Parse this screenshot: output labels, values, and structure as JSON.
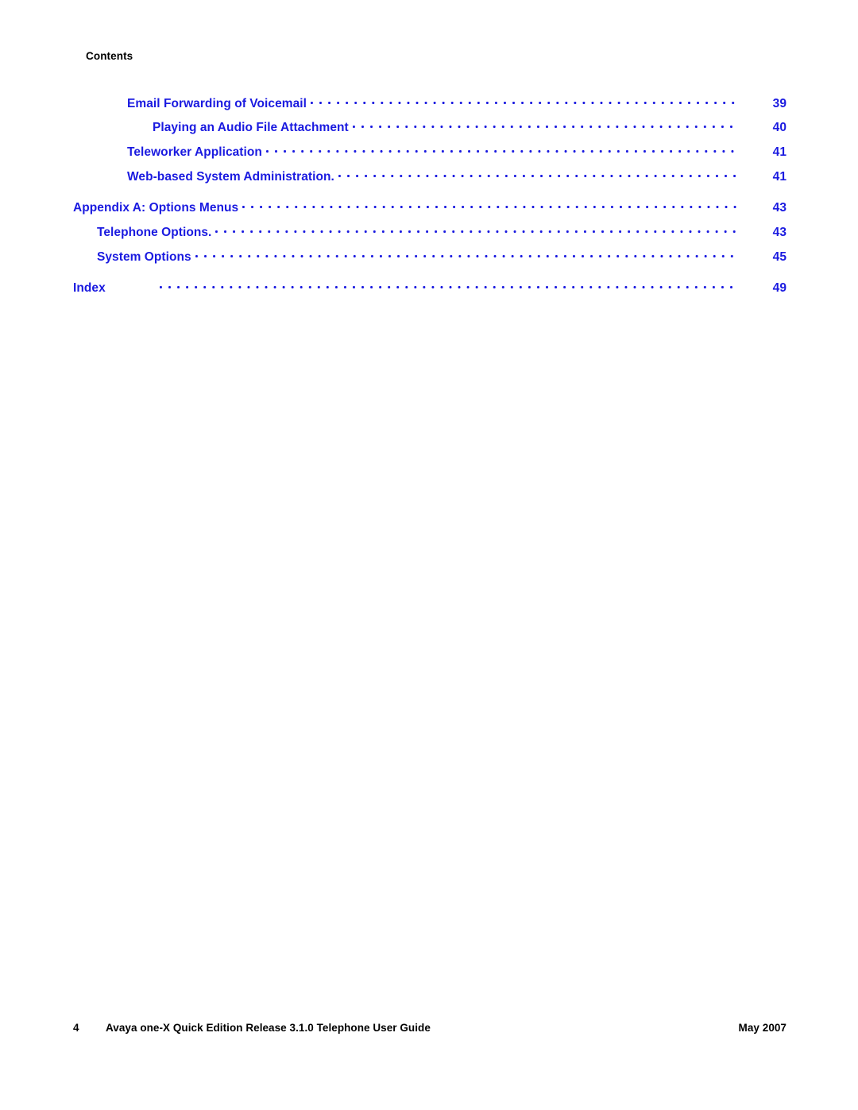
{
  "document": {
    "running_head": "Contents",
    "accent_color": "#1a1ae0",
    "text_color": "#000000",
    "background_color": "#ffffff"
  },
  "toc": {
    "entries": [
      {
        "title": "Email Forwarding of Voicemail",
        "page": "39",
        "level": 2,
        "leader": true,
        "gap_before": false
      },
      {
        "title": "Playing an Audio File Attachment",
        "page": "40",
        "level": 3,
        "leader": true,
        "gap_before": false
      },
      {
        "title": "Teleworker Application",
        "page": "41",
        "level": 2,
        "leader": true,
        "gap_before": false
      },
      {
        "title": "Web-based System Administration.",
        "page": "41",
        "level": 2,
        "leader": true,
        "gap_before": false
      },
      {
        "title": "Appendix A: Options Menus",
        "page": "43",
        "level": 0,
        "leader": true,
        "gap_before": true
      },
      {
        "title": "Telephone Options.",
        "page": "43",
        "level": 1,
        "leader": true,
        "gap_before": false
      },
      {
        "title": "System Options",
        "page": "45",
        "level": 1,
        "leader": true,
        "gap_before": false
      },
      {
        "title": "Index",
        "page": "49",
        "level": 0,
        "leader": true,
        "gap_before": true,
        "wide_gap": true
      }
    ]
  },
  "footer": {
    "folio": "4",
    "title": "Avaya one-X Quick Edition Release 3.1.0 Telephone User Guide",
    "date": "May 2007"
  }
}
